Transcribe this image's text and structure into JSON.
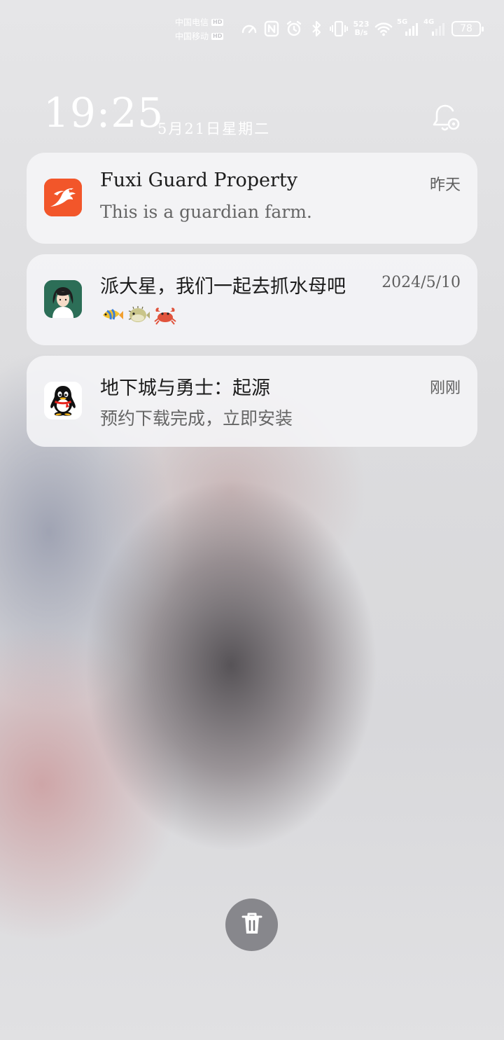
{
  "status_bar": {
    "carriers": [
      {
        "name": "中国电信",
        "badge": "HD"
      },
      {
        "name": "中国移动",
        "badge": "HD"
      }
    ],
    "icons": [
      "speedometer-icon",
      "nfc-icon",
      "alarm-icon",
      "bluetooth-icon",
      "vibrate-icon"
    ],
    "net_speed_value": "523",
    "net_speed_unit": "B/s",
    "wifi_icon": "wifi-icon",
    "sim1_label": "5G",
    "sim2_label": "4G",
    "battery_level": "78"
  },
  "lock_header": {
    "time": "19:25",
    "date": "5月21日星期二",
    "settings_icon": "notification-settings-icon"
  },
  "notifications": [
    {
      "app_icon": "fuxi-guard-app-icon",
      "icon_color": "#f2562a",
      "title": "Fuxi Guard Property",
      "time": "昨天",
      "body": "This is a guardian farm."
    },
    {
      "app_icon": "avatar-girl-icon",
      "icon_color": "#2c6e57",
      "title": "派大星，我们一起去抓水母吧",
      "time": "2024/5/10",
      "body_emojis": [
        "tropical-fish-icon",
        "blowfish-icon",
        "crab-icon"
      ]
    },
    {
      "app_icon": "qq-penguin-icon",
      "icon_color": "#ffffff",
      "title": "地下城与勇士：起源",
      "time": "刚刚",
      "body": "预约下载完成，立即安装"
    }
  ],
  "clear_button": {
    "icon": "trash-icon"
  }
}
